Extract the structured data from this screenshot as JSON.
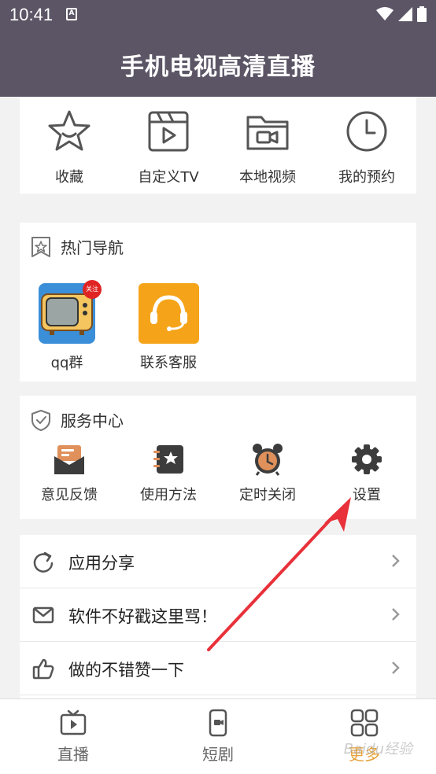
{
  "status_bar": {
    "time": "10:41",
    "notification_icon": "A"
  },
  "app": {
    "title": "手机电视高清直播"
  },
  "quick_actions": [
    {
      "label": "收藏",
      "icon": "star-icon"
    },
    {
      "label": "自定义TV",
      "icon": "clapperboard-icon"
    },
    {
      "label": "本地视频",
      "icon": "video-folder-icon"
    },
    {
      "label": "我的预约",
      "icon": "clock-icon"
    }
  ],
  "hot_nav": {
    "title": "热门导航",
    "items": [
      {
        "label": "qq群",
        "badge": "关注",
        "icon": "tv-icon"
      },
      {
        "label": "联系客服",
        "icon": "headset-icon"
      }
    ]
  },
  "service": {
    "title": "服务中心",
    "items": [
      {
        "label": "意见反馈",
        "icon": "feedback-icon"
      },
      {
        "label": "使用方法",
        "icon": "guide-icon"
      },
      {
        "label": "定时关闭",
        "icon": "alarm-clock-icon"
      },
      {
        "label": "设置",
        "icon": "gear-icon"
      }
    ]
  },
  "menu": [
    {
      "label": "应用分享",
      "icon": "refresh-icon"
    },
    {
      "label": "软件不好戳这里骂！",
      "icon": "mail-icon"
    },
    {
      "label": "做的不错赞一下",
      "icon": "thumbs-up-icon"
    }
  ],
  "tabs": [
    {
      "label": "直播",
      "icon": "tv-tab-icon"
    },
    {
      "label": "短剧",
      "icon": "phone-video-icon"
    },
    {
      "label": "更多",
      "icon": "grid-icon"
    }
  ],
  "watermark": "Baidu经验",
  "colors": {
    "header": "#5c5566",
    "accent": "#e6a23c",
    "arrow": "#e8313a"
  }
}
